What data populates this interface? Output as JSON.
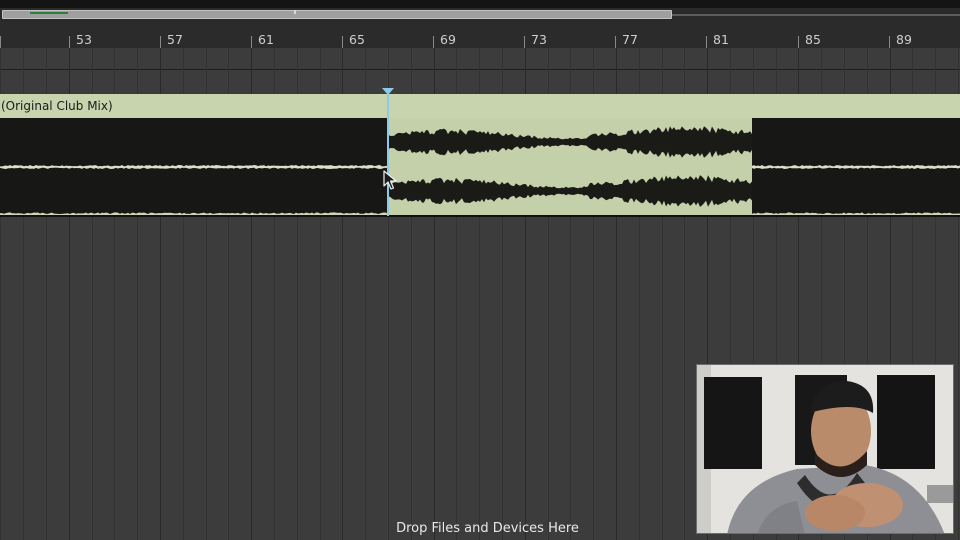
{
  "arrangement": {
    "ruler": {
      "bar_numbers": [
        "53",
        "57",
        "61",
        "65",
        "69",
        "73",
        "77",
        "81",
        "85",
        "89"
      ]
    },
    "clip": {
      "title": "(Original Club Mix)",
      "color": "#c7d4ad",
      "selection_color": "#c3d0a9"
    },
    "playhead_color": "#8ec9e8",
    "drop_hint": "Drop Files and Devices Here"
  },
  "overview": {
    "marker_color": "#2f7d3a"
  },
  "webcam": {
    "description_icon": "webcam-overlay"
  }
}
